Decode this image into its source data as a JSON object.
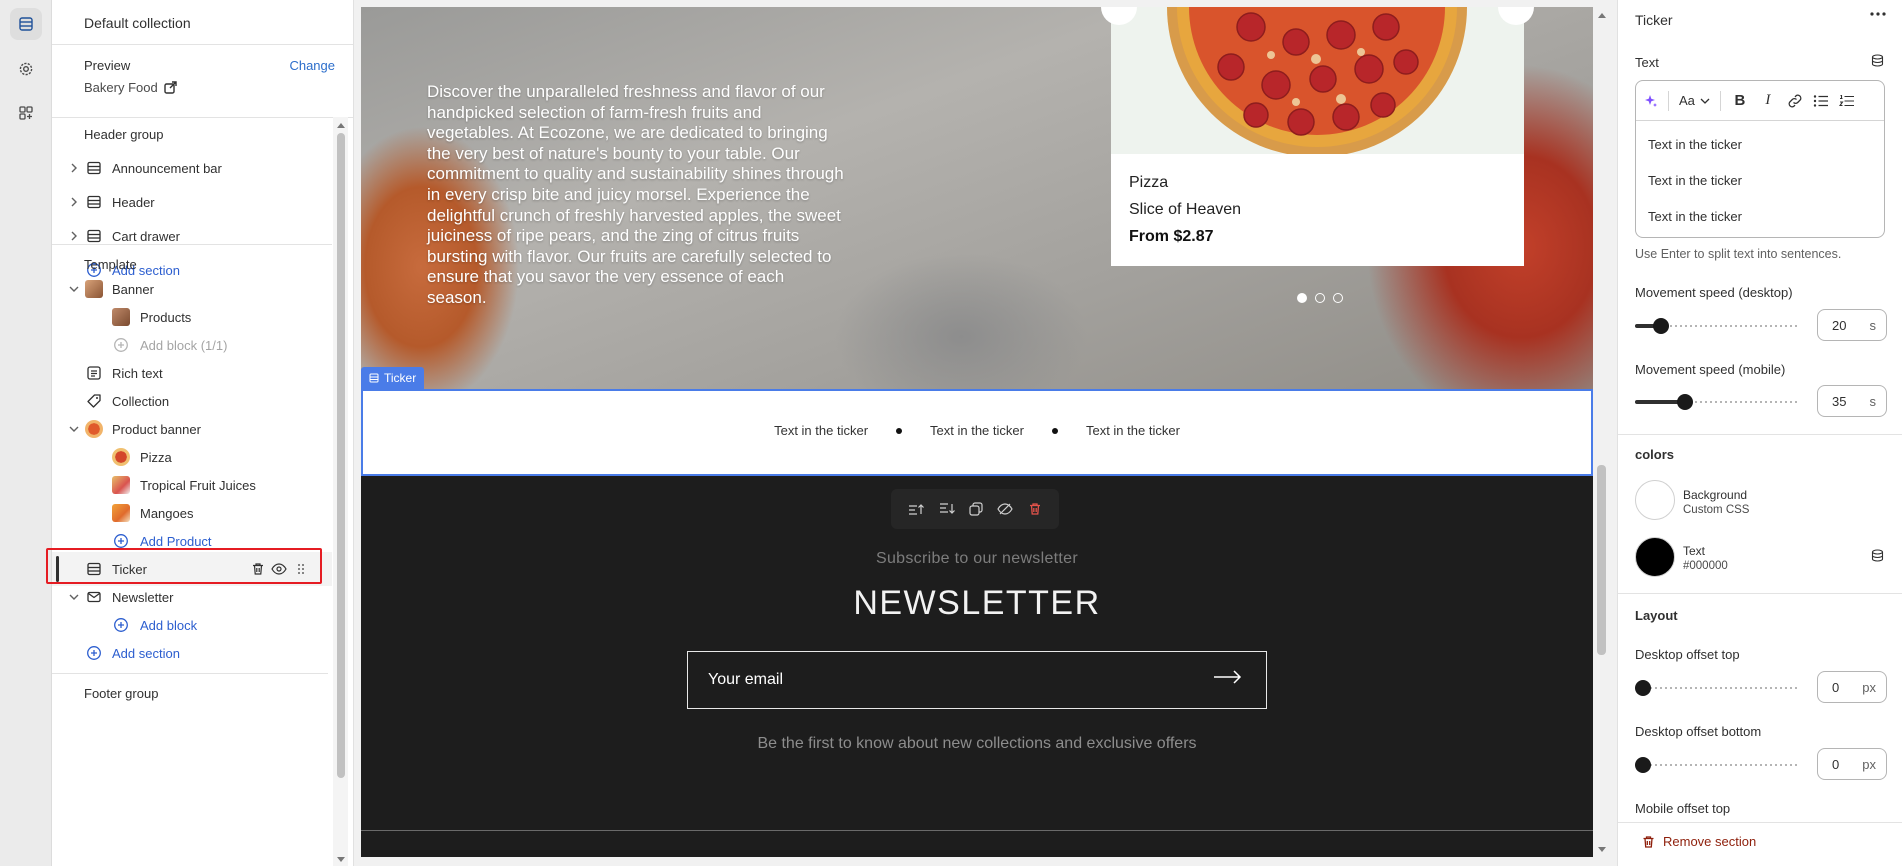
{
  "sidebar": {
    "title": "Default collection",
    "preview": {
      "label": "Preview",
      "change": "Change",
      "value": "Bakery Food"
    },
    "header_group": {
      "title": "Header group",
      "items": [
        "Announcement bar",
        "Header",
        "Cart drawer"
      ],
      "add_section": "Add section"
    },
    "template": {
      "title": "Template",
      "banner": "Banner",
      "banner_products": "Products",
      "banner_add_block": "Add block (1/1)",
      "rich_text": "Rich text",
      "collection": "Collection",
      "product_banner": "Product banner",
      "product_banner_items": [
        "Pizza",
        "Tropical Fruit Juices",
        "Mangoes"
      ],
      "add_product": "Add Product",
      "ticker": "Ticker",
      "newsletter": "Newsletter",
      "newsletter_add_block": "Add block",
      "add_section": "Add section"
    },
    "footer_group": {
      "title": "Footer group"
    }
  },
  "canvas": {
    "hero_text": "Discover the unparalleled freshness and flavor of our handpicked selection of farm-fresh fruits and vegetables. At Ecozone, we are dedicated to bringing the very best of nature's bounty to your table. Our commitment to quality and sustainability shines through in every crisp bite and juicy morsel. Experience the delightful crunch of freshly harvested apples, the sweet juiciness of ripe pears, and the zing of citrus fruits bursting with flavor. Our fruits are carefully selected to ensure that you savor the very essence of each season.",
    "product_card": {
      "name": "Pizza",
      "subtitle": "Slice of Heaven",
      "price": "From $2.87"
    },
    "section_tag": "Ticker",
    "ticker_items": [
      "Text in the ticker",
      "Text in the ticker",
      "Text in the ticker"
    ],
    "newsletter": {
      "subtitle": "Subscribe to our newsletter",
      "title": "NEWSLETTER",
      "email_placeholder": "Your email",
      "footnote": "Be the first to know about new collections and exclusive offers"
    }
  },
  "panel": {
    "title": "Ticker",
    "text_label": "Text",
    "text_lines": [
      "Text in the ticker",
      "Text in the ticker",
      "Text in the ticker"
    ],
    "hint": "Use Enter to split text into sentences.",
    "speed_desktop": {
      "label": "Movement speed (desktop)",
      "value": "20",
      "unit": "s",
      "fraction": 0.16
    },
    "speed_mobile": {
      "label": "Movement speed (mobile)",
      "value": "35",
      "unit": "s",
      "fraction": 0.3
    },
    "colors_title": "colors",
    "background": {
      "name": "Background",
      "value": "Custom CSS",
      "color": "#ffffff"
    },
    "text_color": {
      "name": "Text",
      "value": "#000000",
      "color": "#000000"
    },
    "layout_title": "Layout",
    "offset_top": {
      "label": "Desktop offset top",
      "value": "0",
      "unit": "px"
    },
    "offset_bottom": {
      "label": "Desktop offset bottom",
      "value": "0",
      "unit": "px"
    },
    "mobile_offset_top": {
      "label": "Mobile offset top"
    },
    "remove": "Remove section"
  },
  "colors": {
    "accent": "#2c5ecf",
    "selection": "#4a7ce8",
    "highlight": "#e51c23",
    "danger": "#8e1f0b"
  }
}
